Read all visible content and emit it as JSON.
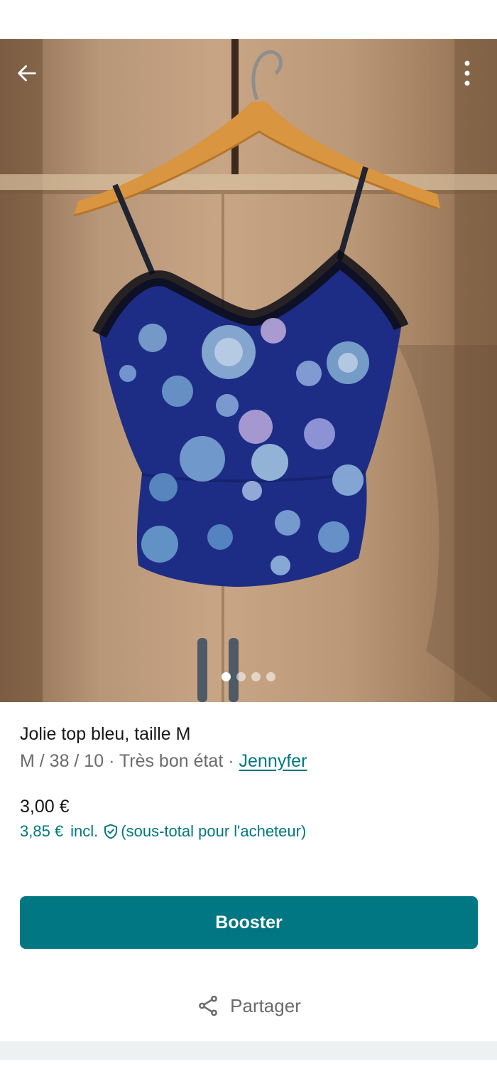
{
  "header": {
    "back_icon": "arrow-left-icon",
    "more_icon": "more-vertical-icon"
  },
  "gallery": {
    "image_count": 4,
    "active_index": 0
  },
  "item": {
    "title": "Jolie top bleu, taille M",
    "size": "M / 38 / 10",
    "separator": "·",
    "condition": "Très bon état",
    "brand": "Jennyfer",
    "price": "3,00 €",
    "price_incl": "3,85 €",
    "incl_label": "incl.",
    "incl_note": "(sous-total pour l'acheteur)"
  },
  "actions": {
    "booster_label": "Booster",
    "share_label": "Partager",
    "share_icon": "share-icon"
  },
  "colors": {
    "accent": "#007782",
    "text_primary": "#171717",
    "text_secondary": "#6b6b6b"
  }
}
